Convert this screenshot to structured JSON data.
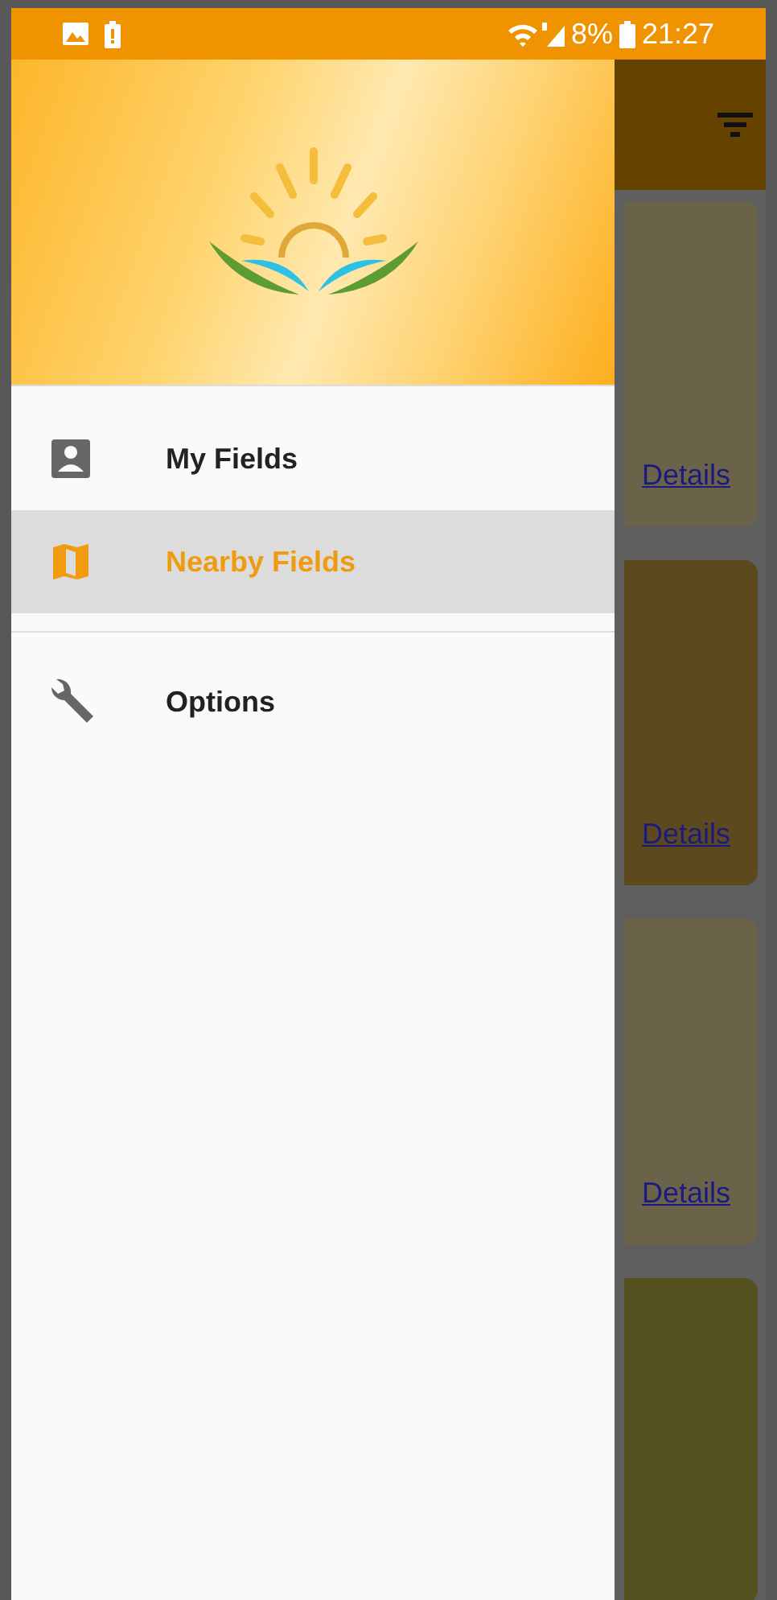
{
  "status_bar": {
    "battery": "8%",
    "time": "21:27"
  },
  "drawer": {
    "items": [
      {
        "label": "My Fields",
        "kind": "person",
        "selected": false
      },
      {
        "label": "Nearby Fields",
        "kind": "map",
        "selected": true
      },
      {
        "label": "Options",
        "kind": "wrench",
        "selected": false
      }
    ]
  },
  "cards": [
    {
      "link": "Details",
      "color": "#6b6349"
    },
    {
      "link": "Details",
      "color": "#5c4a1e"
    },
    {
      "link": "Details",
      "color": "#6b6349"
    },
    {
      "color": "#545220"
    }
  ]
}
